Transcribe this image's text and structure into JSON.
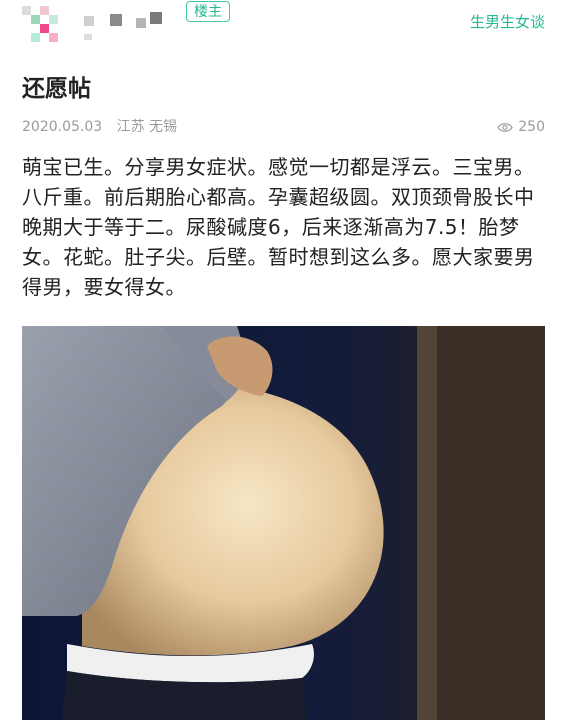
{
  "header": {
    "badge_label": "楼主",
    "topic_label": "生男生女谈",
    "colors": {
      "accent": "#26b892"
    }
  },
  "post": {
    "title": "还愿帖",
    "date": "2020.05.03",
    "location": "江苏 无锡",
    "views": "250",
    "views_icon": "eye-icon",
    "body": "萌宝已生。分享男女症状。感觉一切都是浮云。三宝男。八斤重。前后期胎心都高。孕囊超级圆。双顶颈骨股长中晚期大于等于二。尿酸碱度6，后来逐渐高为7.5！胎梦女。花蛇。肚子尖。后壁。暂时想到这么多。愿大家要男得男，要女得女。"
  }
}
